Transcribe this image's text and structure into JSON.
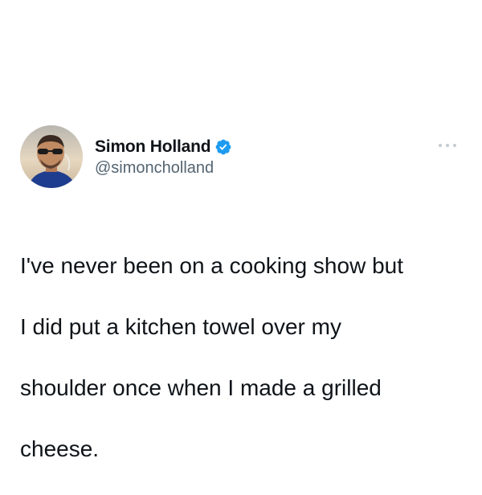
{
  "tweet": {
    "author": {
      "display_name": "Simon Holland",
      "handle": "@simoncholland",
      "verified": true,
      "avatar_icon": "profile-photo"
    },
    "more_icon": "ellipsis-icon",
    "text_lines": [
      "I've never been on a cooking show but",
      "I did put a kitchen towel over my",
      "shoulder once when I made a grilled",
      "cheese."
    ]
  },
  "colors": {
    "background": "#ffffff",
    "text_primary": "#0f1419",
    "text_secondary": "#536471",
    "verified_blue": "#1d9bf0",
    "more_dots": "#c4cbd1"
  }
}
